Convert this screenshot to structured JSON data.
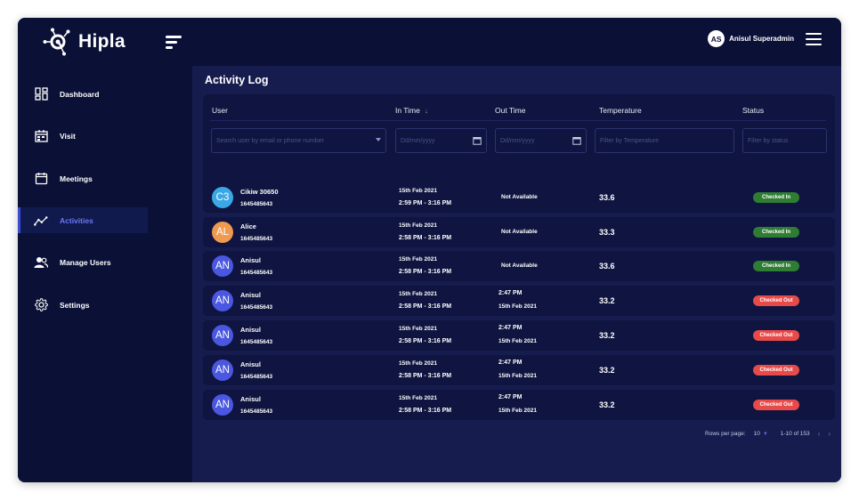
{
  "brand": {
    "name": "Hipla"
  },
  "header": {
    "user_initials": "AS",
    "user_name": "Anisul Superadmin"
  },
  "sidebar": {
    "items": [
      {
        "label": "Dashboard",
        "icon": "dashboard-icon"
      },
      {
        "label": "Visit",
        "icon": "visit-icon"
      },
      {
        "label": "Meetings",
        "icon": "calendar-icon"
      },
      {
        "label": "Activities",
        "icon": "activity-chart-icon",
        "active": true
      },
      {
        "label": "Manage Users",
        "icon": "users-icon"
      },
      {
        "label": "Settings",
        "icon": "gear-icon"
      }
    ]
  },
  "page": {
    "title": "Activity Log"
  },
  "table": {
    "columns": {
      "user": "User",
      "in_time": "In Time",
      "out_time": "Out Time",
      "temperature": "Temperature",
      "status": "Status"
    },
    "filters": {
      "user_placeholder": "Search user by email or phone number",
      "in_time_placeholder": "Dd/mm/yyyy",
      "out_time_placeholder": "Dd/mm/yyyy",
      "temperature_placeholder": "Filter by Temperature",
      "status_placeholder": "Filter by status"
    },
    "rows": [
      {
        "initials": "C3",
        "avatar_color": "#3aa8e6",
        "name": "Cikiw 30650",
        "phone": "1645485643",
        "in_date": "15th Feb 2021",
        "in_range": "2:59 PM - 3:16 PM",
        "out_time": "",
        "out_date": "",
        "out_na": "Not Available",
        "temperature": "33.6",
        "status": "Checked In"
      },
      {
        "initials": "AL",
        "avatar_color": "#ef9a4e",
        "name": "Alice",
        "phone": "1645485643",
        "in_date": "15th Feb 2021",
        "in_range": "2:58 PM - 3:16 PM",
        "out_time": "",
        "out_date": "",
        "out_na": "Not Available",
        "temperature": "33.3",
        "status": "Checked In"
      },
      {
        "initials": "AN",
        "avatar_color": "#4a57e0",
        "name": "Anisul",
        "phone": "1645485643",
        "in_date": "15th Feb 2021",
        "in_range": "2:58 PM - 3:16 PM",
        "out_time": "",
        "out_date": "",
        "out_na": "Not Available",
        "temperature": "33.6",
        "status": "Checked In"
      },
      {
        "initials": "AN",
        "avatar_color": "#4a57e0",
        "name": "Anisul",
        "phone": "1645485643",
        "in_date": "15th Feb 2021",
        "in_range": "2:58 PM - 3:16 PM",
        "out_time": "2:47 PM",
        "out_date": "15th Feb 2021",
        "out_na": "",
        "temperature": "33.2",
        "status": "Checked Out"
      },
      {
        "initials": "AN",
        "avatar_color": "#4a57e0",
        "name": "Anisul",
        "phone": "1645485643",
        "in_date": "15th Feb 2021",
        "in_range": "2:58 PM - 3:16 PM",
        "out_time": "2:47 PM",
        "out_date": "15th Feb 2021",
        "out_na": "",
        "temperature": "33.2",
        "status": "Checked Out"
      },
      {
        "initials": "AN",
        "avatar_color": "#4a57e0",
        "name": "Anisul",
        "phone": "1645485643",
        "in_date": "15th Feb 2021",
        "in_range": "2:58 PM - 3:16 PM",
        "out_time": "2:47 PM",
        "out_date": "15th Feb 2021",
        "out_na": "",
        "temperature": "33.2",
        "status": "Checked Out"
      },
      {
        "initials": "AN",
        "avatar_color": "#4a57e0",
        "name": "Anisul",
        "phone": "1645485643",
        "in_date": "15th Feb 2021",
        "in_range": "2:58 PM - 3:16 PM",
        "out_time": "2:47 PM",
        "out_date": "15th Feb 2021",
        "out_na": "",
        "temperature": "33.2",
        "status": "Checked Out"
      }
    ]
  },
  "status_colors": {
    "Checked In": "#2e7d32",
    "Checked Out": "#e84a4a"
  },
  "pagination": {
    "rows_per_page_label": "Rows per page:",
    "rows_per_page": "10",
    "range": "1-10 of 153",
    "prev": "‹",
    "next": "›"
  }
}
